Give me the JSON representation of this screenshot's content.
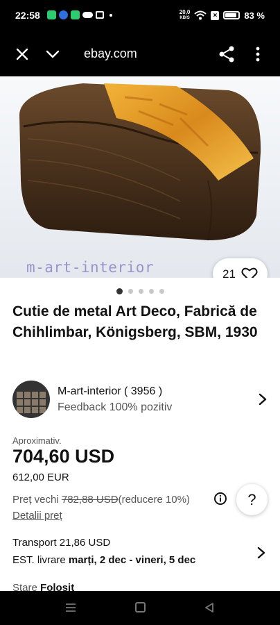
{
  "status_bar": {
    "time": "22:58",
    "net_speed_value": "20,0",
    "net_speed_unit": "KB/S",
    "battery_percent": "83 %"
  },
  "browser": {
    "url": "ebay.com"
  },
  "product": {
    "image_watermark": "m-art-interior",
    "likes": "21",
    "image_pages": 5,
    "active_page": 0,
    "title": "Cutie de metal Art Deco, Fabrică de Chihlimbar, Königsberg, SBM, 1930"
  },
  "seller": {
    "name": "M-art-interior ( 3956 )",
    "feedback": "Feedback 100% pozitiv",
    "avatar_text": "M-art-interior"
  },
  "pricing": {
    "approx_label": "Aproximativ.",
    "price_usd": "704,60 USD",
    "price_eur": "612,00 EUR",
    "old_price_label": "Preț vechi",
    "old_price": "782,88 USD",
    "discount": "(reducere 10%)",
    "details_link": "Detalii preț",
    "help": "?"
  },
  "shipping": {
    "transport": "Transport 21,86 USD",
    "est_prefix": "EST. livrare ",
    "est_dates": "marți, 2 dec - vineri, 5 dec"
  },
  "condition": {
    "label": "Stare",
    "value": "Folosit"
  },
  "colors": {
    "accent_dark": "#111111",
    "muted_text": "#555555",
    "watermark": "#9a93c9"
  }
}
